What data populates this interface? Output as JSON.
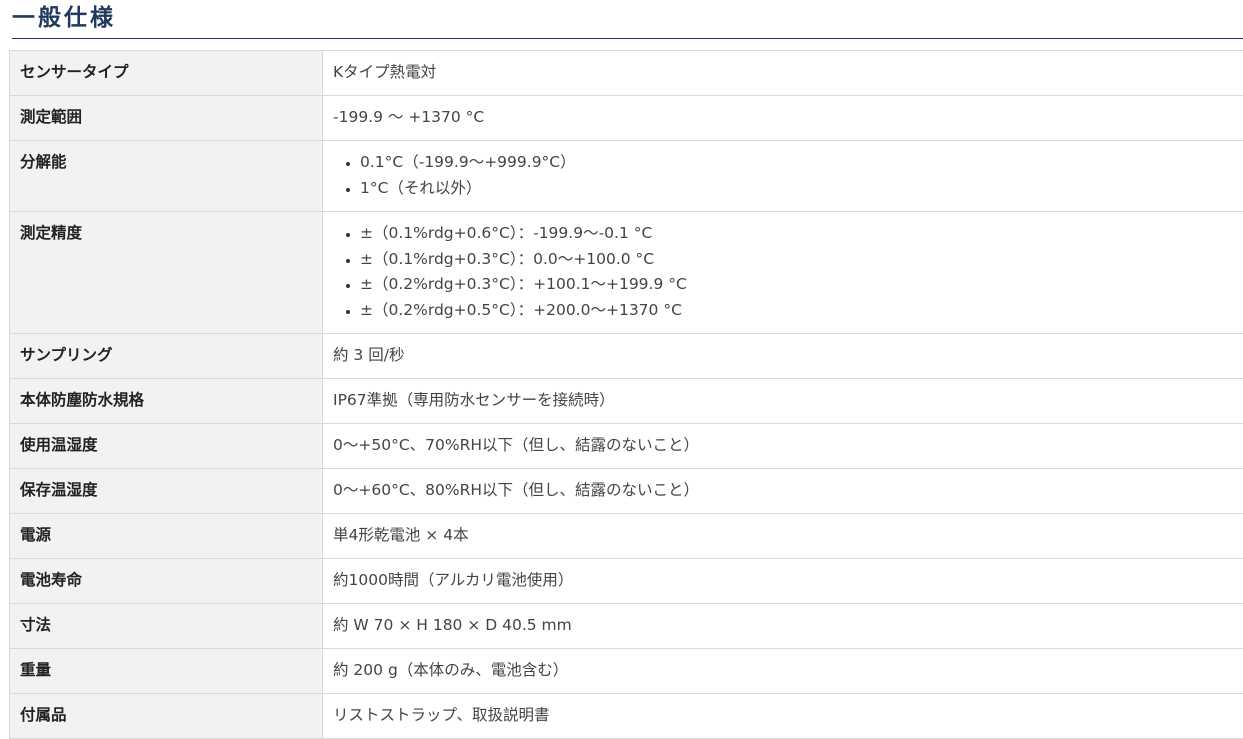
{
  "section": {
    "title": "一般仕様"
  },
  "specs": {
    "sensor_type": {
      "label": "センサータイプ",
      "value": "Kタイプ熱電対"
    },
    "range": {
      "label": "測定範囲",
      "value": "-199.9 ～ +1370 °C"
    },
    "resolution": {
      "label": "分解能",
      "items": [
        "0.1°C（-199.9～+999.9°C）",
        "1°C（それ以外）"
      ]
    },
    "accuracy": {
      "label": "測定精度",
      "items": [
        "±（0.1%rdg+0.6°C）：-199.9～-0.1 °C",
        "±（0.1%rdg+0.3°C）：0.0～+100.0 °C",
        "±（0.2%rdg+0.3°C）：+100.1～+199.9 °C",
        "±（0.2%rdg+0.5°C）：+200.0～+1370 °C"
      ]
    },
    "sampling": {
      "label": "サンプリング",
      "value": "約 3 回/秒"
    },
    "protection": {
      "label": "本体防塵防水規格",
      "value": "IP67準拠（専用防水センサーを接続時）"
    },
    "operating_env": {
      "label": "使用温湿度",
      "value": "0～+50°C、70%RH以下（但し、結露のないこと）"
    },
    "storage_env": {
      "label": "保存温湿度",
      "value": "0～+60°C、80%RH以下（但し、結露のないこと）"
    },
    "power": {
      "label": "電源",
      "value": "単4形乾電池 × 4本"
    },
    "battery_life": {
      "label": "電池寿命",
      "value": "約1000時間（アルカリ電池使用）"
    },
    "dimensions": {
      "label": "寸法",
      "value": "約 W 70 × H 180 × D 40.5 mm"
    },
    "weight": {
      "label": "重量",
      "value": "約 200 g（本体のみ、電池含む）"
    },
    "accessories": {
      "label": "付属品",
      "value": "リストストラップ、取扱説明書"
    }
  }
}
